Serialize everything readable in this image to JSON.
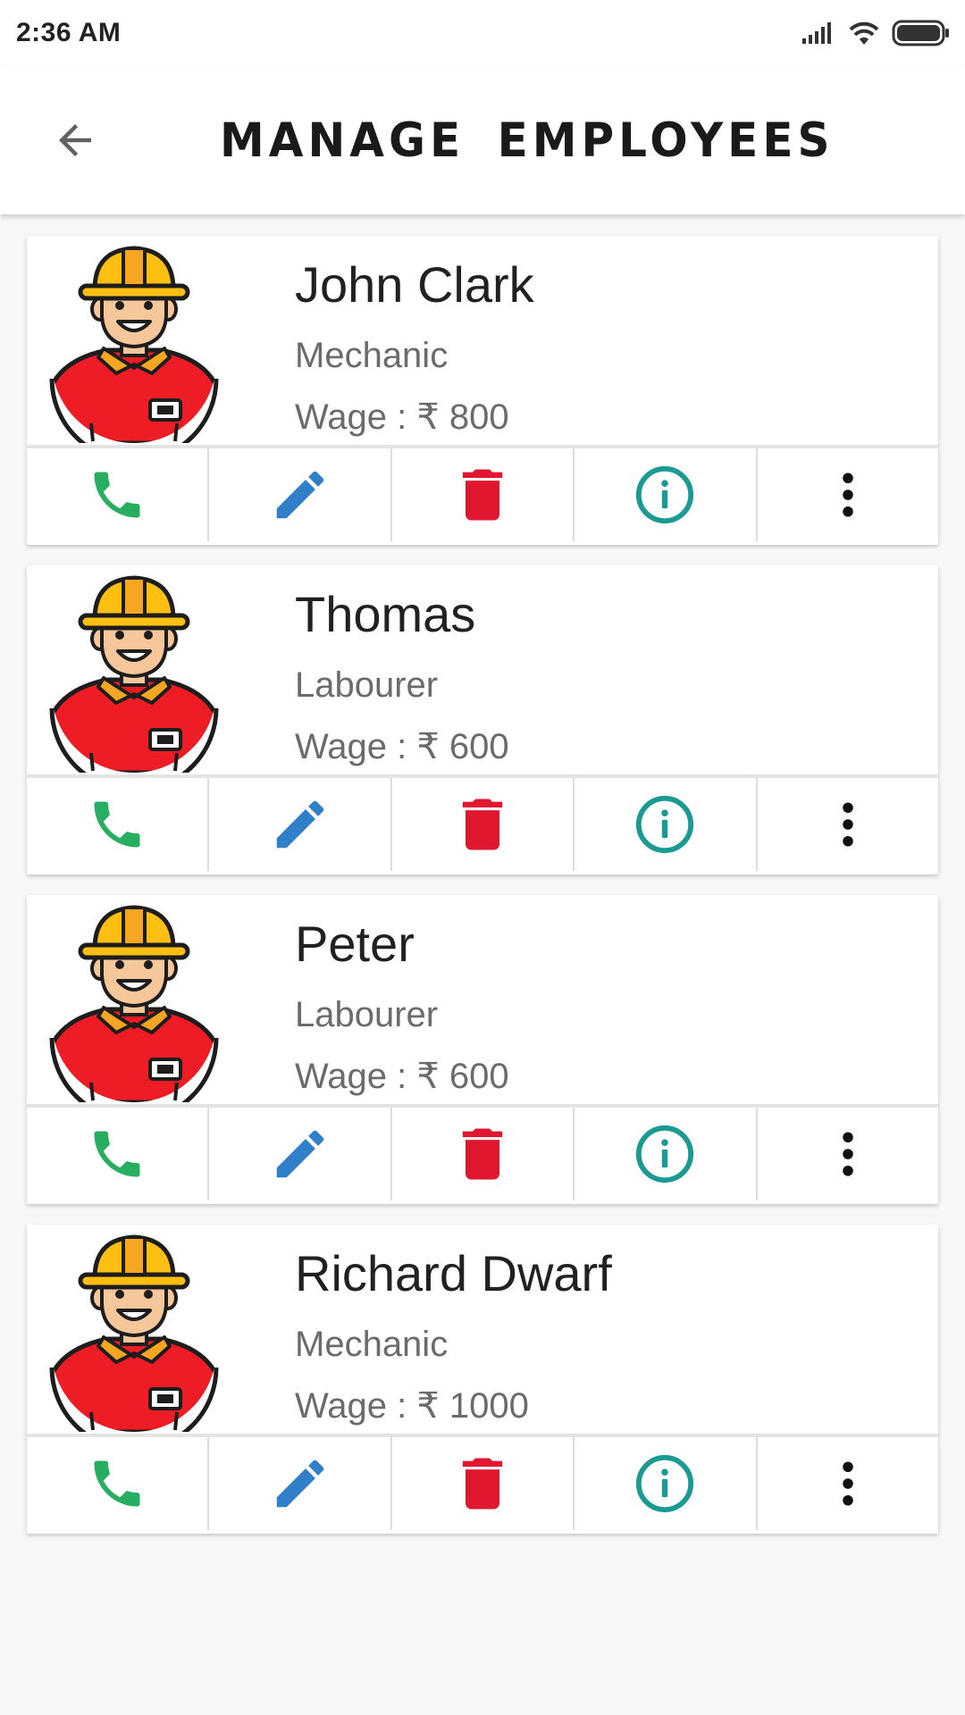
{
  "status_bar": {
    "time": "2:36 AM"
  },
  "header": {
    "title": "MANAGE EMPLOYEES"
  },
  "employees": [
    {
      "name": "John Clark",
      "role": "Mechanic",
      "wage": "Wage : ₹ 800"
    },
    {
      "name": "Thomas",
      "role": "Labourer",
      "wage": "Wage : ₹ 600"
    },
    {
      "name": "Peter",
      "role": "Labourer",
      "wage": "Wage : ₹ 600"
    },
    {
      "name": "Richard Dwarf",
      "role": "Mechanic",
      "wage": "Wage : ₹ 1000"
    }
  ],
  "colors": {
    "call": "#27ae60",
    "edit": "#2f80c9",
    "delete": "#e0172e",
    "info": "#1b9a94",
    "more": "#111111"
  },
  "icons": [
    "back-arrow-icon",
    "call-icon",
    "edit-icon",
    "delete-icon",
    "info-icon",
    "more-vert-icon",
    "worker-avatar-icon"
  ]
}
